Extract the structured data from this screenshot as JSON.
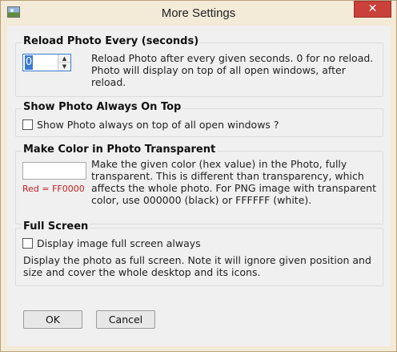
{
  "window": {
    "title": "More Settings",
    "close_glyph": "✕"
  },
  "reload": {
    "title": "Reload Photo Every (seconds)",
    "value": "0",
    "description": "Reload Photo after every given seconds. 0 for no reload.\nPhoto will display on top of all open windows, after\nreload."
  },
  "always_on_top": {
    "title": "Show Photo Always On Top",
    "checkbox_label": "Show Photo always on top of all open windows ?",
    "checked": false
  },
  "transparent": {
    "title": "Make Color in Photo Transparent",
    "value": "",
    "hint": "Red = FF0000",
    "description": "Make the given color (hex value) in the Photo, fully\ntransparent. This is different than transparency, which\naffects the whole photo. For PNG image with transparent\ncolor, use 000000 (black) or FFFFFF (white)."
  },
  "full_screen": {
    "title": "Full Screen",
    "checkbox_label": "Display image full screen always",
    "checked": false,
    "description": "Display the photo as full screen. Note it will ignore given position and\nsize and cover the whole desktop and its icons."
  },
  "buttons": {
    "ok": "OK",
    "cancel": "Cancel"
  }
}
